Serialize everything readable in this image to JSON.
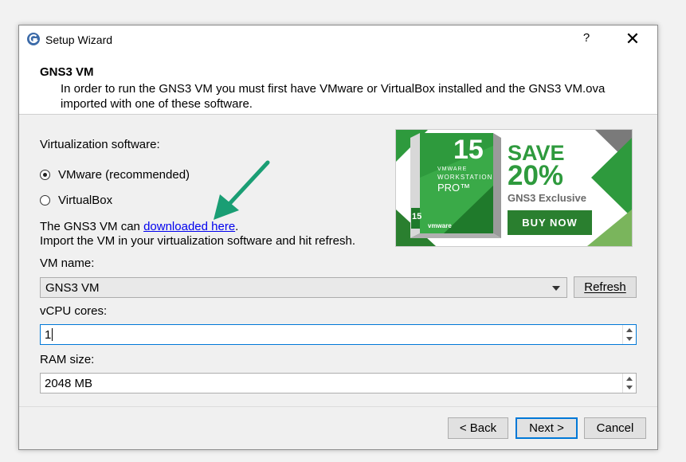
{
  "window": {
    "title": "Setup Wizard",
    "help_label": "?",
    "close_label": "✕"
  },
  "header": {
    "title": "GNS3 VM",
    "description": "In order to run the GNS3 VM you must first have VMware or VirtualBox installed and the GNS3 VM.ova imported with one of these software."
  },
  "virtualization": {
    "label": "Virtualization software:",
    "options": [
      {
        "label": "VMware (recommended)",
        "selected": true
      },
      {
        "label": "VirtualBox",
        "selected": false
      }
    ]
  },
  "info": {
    "line1_prefix": "The GNS3 VM can ",
    "line1_link": "downloaded here",
    "line1_suffix": ".",
    "line2": "Import the VM in your virtualization software and hit refresh."
  },
  "ad": {
    "version": "15",
    "product_line1": "VMWARE",
    "product_line2": "WORKSTATION",
    "product_line3": "PRO™",
    "box_badge": "15",
    "box_logo": "vmware",
    "save_text": "SAVE",
    "discount": "20%",
    "subtitle": "GNS3 Exclusive",
    "button_label": "BUY NOW",
    "accent_color": "#2e9a3d",
    "button_color": "#2a7f2f"
  },
  "vm_name": {
    "label": "VM name:",
    "value": "GNS3 VM",
    "refresh_label": "Refresh"
  },
  "vcpu": {
    "label": "vCPU cores:",
    "value": "1"
  },
  "ram": {
    "label": "RAM size:",
    "value": "2048 MB"
  },
  "footer": {
    "back_label": "< Back",
    "next_label": "Next >",
    "cancel_label": "Cancel"
  }
}
